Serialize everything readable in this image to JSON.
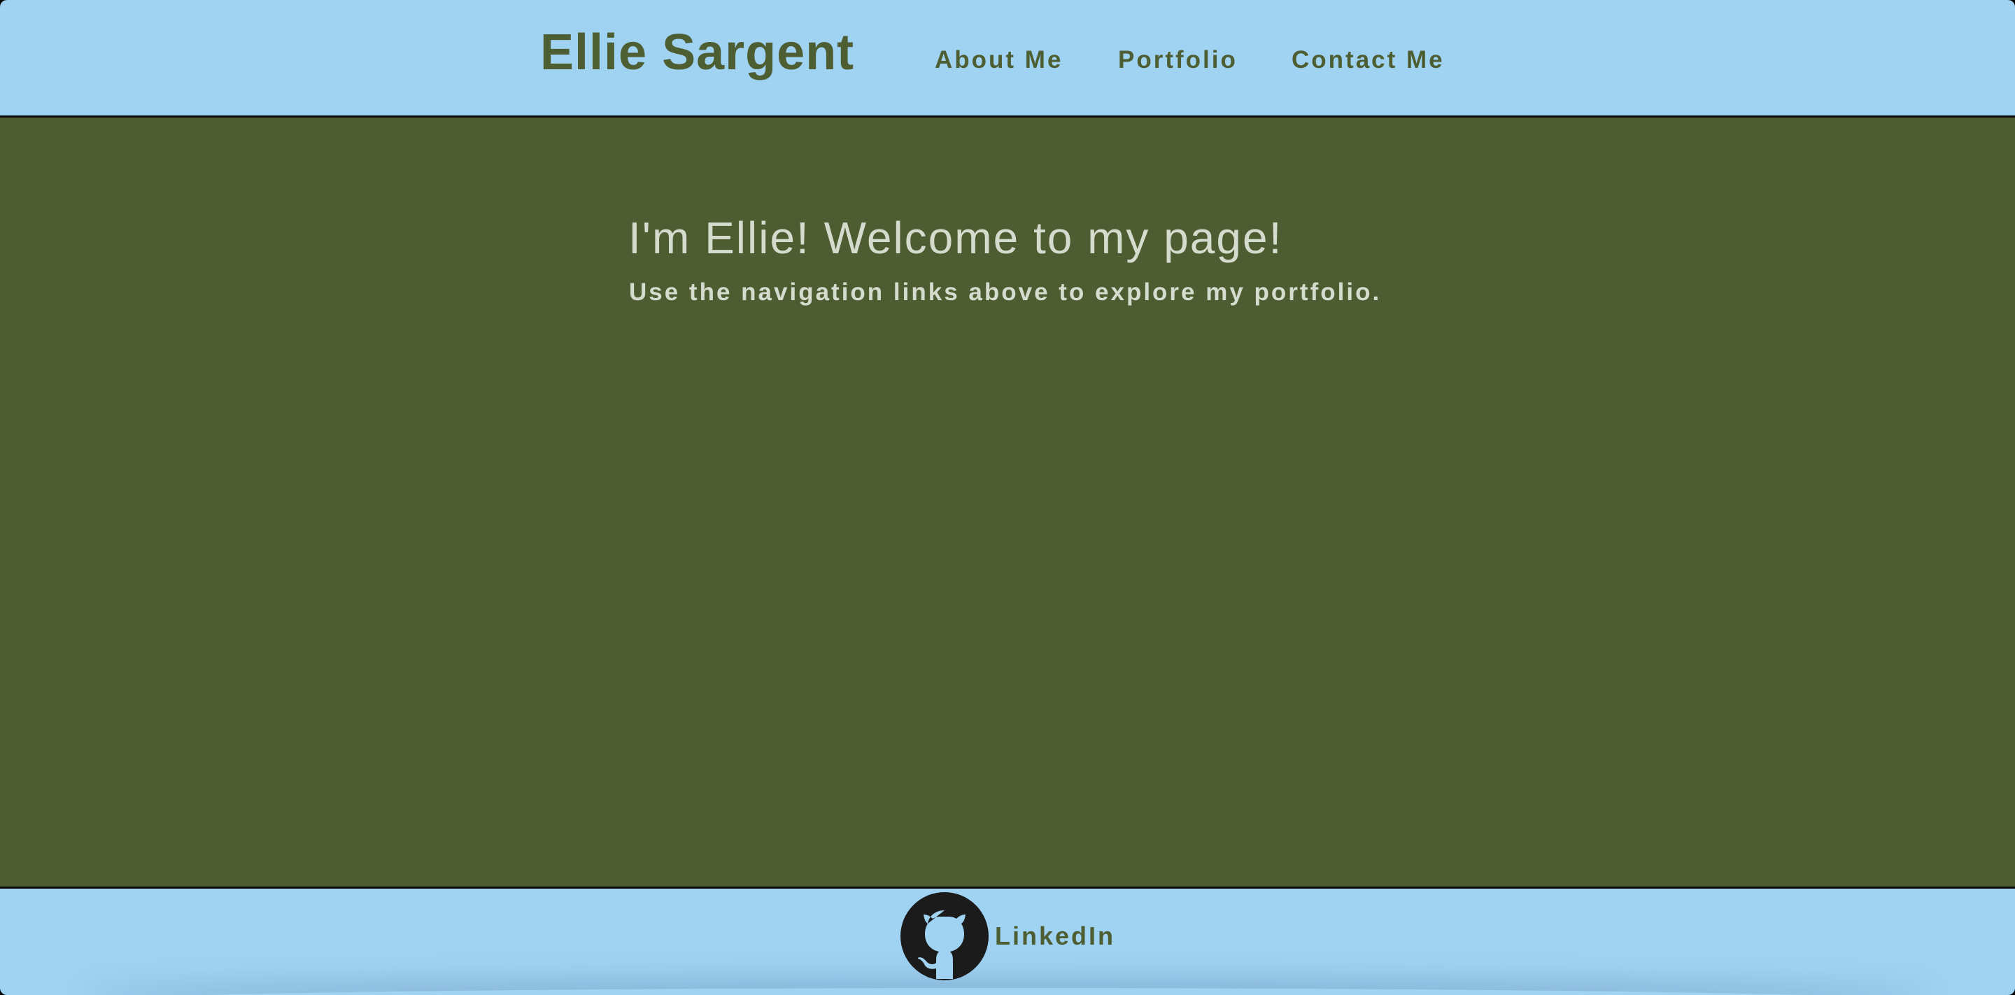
{
  "header": {
    "title": "Ellie Sargent",
    "nav": {
      "about_label": "About Me",
      "portfolio_label": "Portfolio",
      "contact_label": "Contact Me"
    }
  },
  "hero": {
    "heading": "I'm Ellie! Welcome to my page!",
    "subtext": "Use the navigation links above to explore my portfolio."
  },
  "footer": {
    "github_icon": "github-icon",
    "linkedin_label": "LinkedIn"
  },
  "colors": {
    "header_background": "#a0d2f2",
    "hero_background": "#4e5c32",
    "title_text": "#4e5e33",
    "hero_text": "#d5dccd",
    "divider": "#0b0b0b"
  }
}
